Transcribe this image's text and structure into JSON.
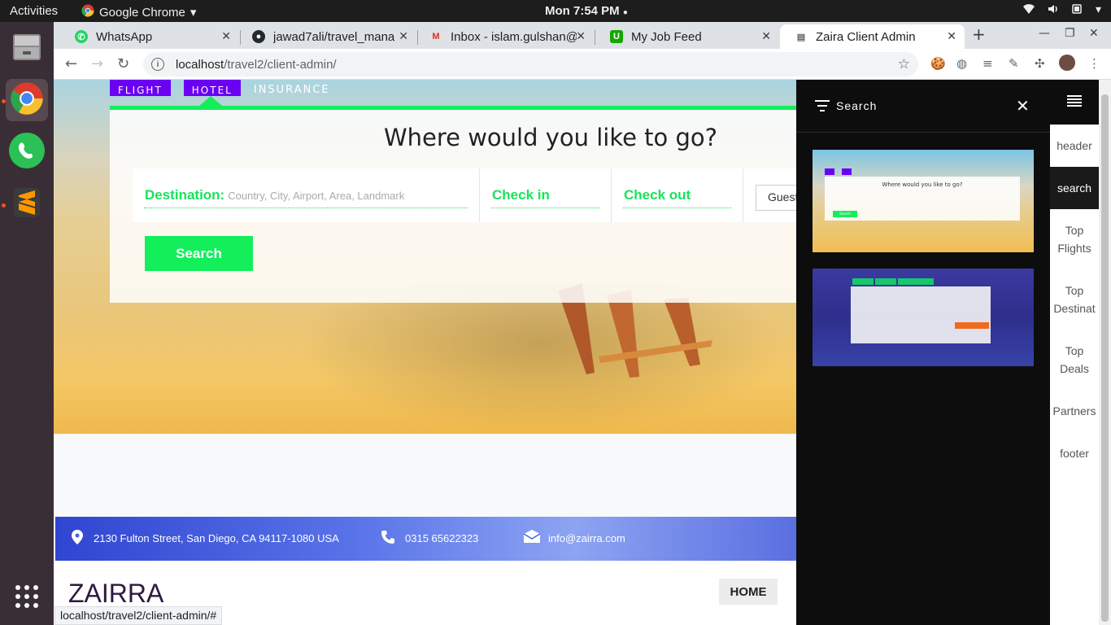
{
  "os": {
    "activities": "Activities",
    "app_name": "Google Chrome",
    "clock": "Mon  7:54 PM"
  },
  "browser": {
    "tabs": [
      {
        "title": "WhatsApp"
      },
      {
        "title": "jawad7ali/travel_mana"
      },
      {
        "title": "Inbox - islam.gulshan@"
      },
      {
        "title": "My Job Feed"
      },
      {
        "title": "Zaira Client Admin"
      }
    ],
    "url_host": "localhost",
    "url_path": "/travel2/client-admin/",
    "status_url": "localhost/travel2/client-admin/#"
  },
  "page": {
    "nav": {
      "first": "FLIGHT",
      "second": "HOTEL",
      "third": "INSURANCE"
    },
    "search_title": "Where would you like to go?",
    "destination_label": "Destination:",
    "destination_placeholder": "Country, City, Airport, Area, Landmark",
    "checkin_label": "Check in",
    "checkout_label": "Check out",
    "guest_label": "Guest",
    "search_button": "Search",
    "address": "2130 Fulton Street, San Diego, CA 94117-1080 USA",
    "phone": "0315 65622323",
    "email": "info@zairra.com",
    "logo": "ZAIRRA",
    "home_button": "HOME"
  },
  "panel": {
    "title": "Search",
    "thumb1_caption": "Where would you like to go?",
    "thumb1_button": "Search"
  },
  "sidenav": {
    "items": [
      "header",
      "search",
      "Top Flights",
      "Top Destinat",
      "Top Deals",
      "Partners",
      "footer"
    ],
    "active": "search"
  },
  "colors": {
    "accent_green": "#13ee5b",
    "nav_purple": "#6a00f4",
    "info_blue": "#3045d1"
  }
}
